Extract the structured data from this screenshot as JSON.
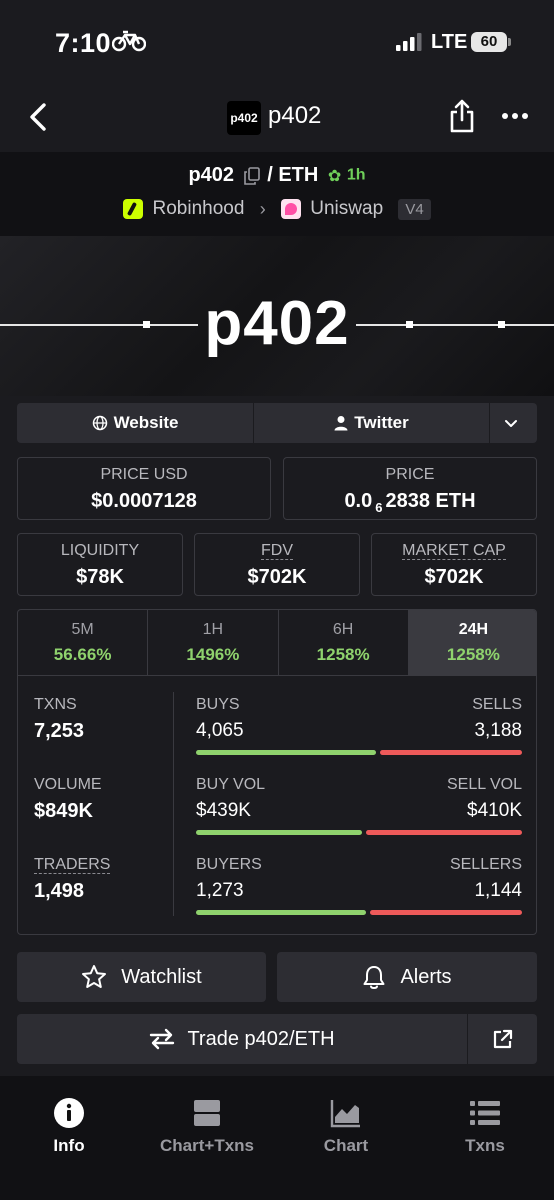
{
  "status_bar": {
    "time": "7:10",
    "network": "LTE",
    "battery": "60"
  },
  "nav": {
    "logo_text": "p402",
    "title": "p402"
  },
  "pair": {
    "base": "p402",
    "separator": "/",
    "quote": "ETH",
    "age": "1h",
    "chain": "Robinhood",
    "dex": "Uniswap",
    "version": "V4"
  },
  "banner": {
    "title": "p402"
  },
  "links": {
    "website": "Website",
    "twitter": "Twitter"
  },
  "stats": {
    "price_usd_label": "PRICE USD",
    "price_usd": "$0.0007128",
    "price_label": "PRICE",
    "price_prefix": "0.0",
    "price_sub": "6",
    "price_suffix": "2838 ETH",
    "liquidity_label": "LIQUIDITY",
    "liquidity": "$78K",
    "fdv_label": "FDV",
    "fdv": "$702K",
    "mcap_label": "MARKET CAP",
    "mcap": "$702K"
  },
  "periods": [
    {
      "label": "5M",
      "change": "56.66%"
    },
    {
      "label": "1H",
      "change": "1496%"
    },
    {
      "label": "6H",
      "change": "1258%"
    },
    {
      "label": "24H",
      "change": "1258%"
    }
  ],
  "metrics": {
    "txns_label": "TXNS",
    "txns": "7,253",
    "volume_label": "VOLUME",
    "volume": "$849K",
    "traders_label": "TRADERS",
    "traders": "1,498",
    "buys_label": "BUYS",
    "buys": "4,065",
    "sells_label": "SELLS",
    "sells": "3,188",
    "buys_share": 0.56,
    "buyvol_label": "BUY VOL",
    "buyvol": "$439K",
    "sellvol_label": "SELL VOL",
    "sellvol": "$410K",
    "buyvol_share": 0.517,
    "buyers_label": "BUYERS",
    "buyers": "1,273",
    "sellers_label": "SELLERS",
    "sellers": "1,144",
    "buyers_share": 0.527
  },
  "actions": {
    "watchlist": "Watchlist",
    "alerts": "Alerts",
    "trade": "Trade p402/ETH"
  },
  "bottom_nav": {
    "info": "Info",
    "chart_txns": "Chart+Txns",
    "chart": "Chart",
    "txns": "Txns"
  },
  "colors": {
    "positive": "#8fd26d",
    "negative": "#ee5a5a",
    "background": "#1b1b1f",
    "surface": "#2d2d33"
  }
}
